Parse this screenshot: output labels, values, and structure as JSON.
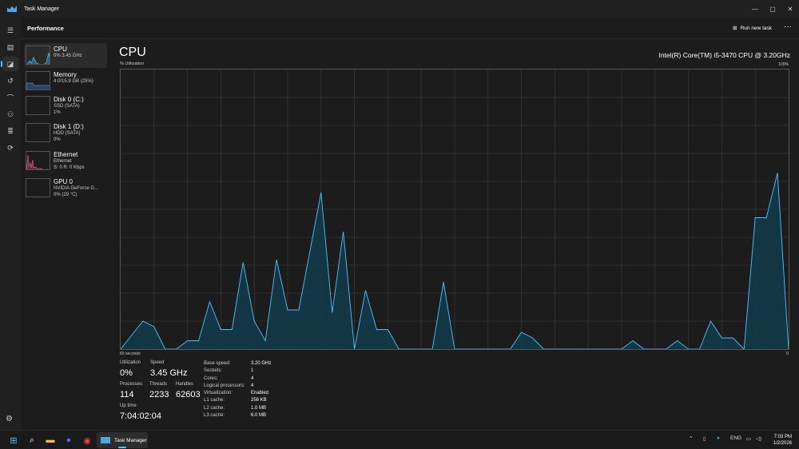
{
  "window": {
    "title": "Task Manager",
    "minimize": "—",
    "maximize": "▢",
    "close": "✕"
  },
  "header": {
    "title": "Performance",
    "run_new_task": "Run new task",
    "more": "···"
  },
  "rail": {
    "items": [
      "menu-icon",
      "processes-icon",
      "performance-icon",
      "app-history-icon",
      "startup-icon",
      "users-icon",
      "details-icon",
      "services-icon"
    ],
    "settings": "settings-icon"
  },
  "nav": {
    "items": [
      {
        "name": "CPU",
        "sub1": "0% 3.45 GHz",
        "sub2": "",
        "color": "#4cc2ff"
      },
      {
        "name": "Memory",
        "sub1": "4.0/15.9 GB (25%)",
        "sub2": "",
        "color": "#4a8fe0"
      },
      {
        "name": "Disk 0 (C:)",
        "sub1": "SSD (SATA)",
        "sub2": "1%",
        "color": "#7fba00"
      },
      {
        "name": "Disk 1 (D:)",
        "sub1": "HDD (SATA)",
        "sub2": "0%",
        "color": "#7fba00"
      },
      {
        "name": "Ethernet",
        "sub1": "Ethernet",
        "sub2": "S: 0 R: 0 Kbps",
        "color": "#e05a8a"
      },
      {
        "name": "GPU 0",
        "sub1": "NVIDIA GeForce G...",
        "sub2": "0% (29 °C)",
        "color": "#4cc2ff"
      }
    ]
  },
  "main": {
    "title": "CPU",
    "model": "Intel(R) Core(TM) i5-3470 CPU @ 3.20GHz"
  },
  "chart_data": {
    "type": "area",
    "ylabel": "% Utilization",
    "ymax_label": "100%",
    "xlabel": "60 seconds",
    "xmin_label": "0",
    "ylim": [
      0,
      100
    ],
    "xlim": [
      60,
      0
    ],
    "grid": true,
    "color": "#4cc2ff",
    "values": [
      0,
      5,
      10,
      8,
      0,
      0,
      3,
      3,
      17,
      7,
      7,
      31,
      10,
      3,
      32,
      14,
      14,
      35,
      56,
      13,
      42,
      0,
      21,
      7,
      7,
      0,
      0,
      0,
      0,
      24,
      0,
      0,
      0,
      0,
      0,
      0,
      6,
      4,
      0,
      0,
      0,
      0,
      0,
      0,
      0,
      0,
      3,
      0,
      0,
      0,
      3,
      0,
      0,
      10,
      4,
      4,
      0,
      47,
      47,
      63,
      0
    ]
  },
  "stats": {
    "utilization": {
      "label": "Utilization",
      "value": "0%"
    },
    "speed": {
      "label": "Speed",
      "value": "3.45 GHz"
    },
    "processes": {
      "label": "Processes",
      "value": "114"
    },
    "threads": {
      "label": "Threads",
      "value": "2233"
    },
    "handles": {
      "label": "Handles",
      "value": "62603"
    },
    "uptime": {
      "label": "Up time",
      "value": "7:04:02:04"
    }
  },
  "specs": [
    {
      "k": "Base speed:",
      "v": "3.20 GHz"
    },
    {
      "k": "Sockets:",
      "v": "1"
    },
    {
      "k": "Cores:",
      "v": "4"
    },
    {
      "k": "Logical processors:",
      "v": "4"
    },
    {
      "k": "Virtualization:",
      "v": "Enabled"
    },
    {
      "k": "L1 cache:",
      "v": "256 KB"
    },
    {
      "k": "L2 cache:",
      "v": "1.0 MB"
    },
    {
      "k": "L3 cache:",
      "v": "6.0 MB"
    }
  ],
  "taskbar": {
    "task_manager": "Task Manager",
    "lang": "ENG",
    "time": "7:03 PM",
    "date": "1/2/2026"
  }
}
